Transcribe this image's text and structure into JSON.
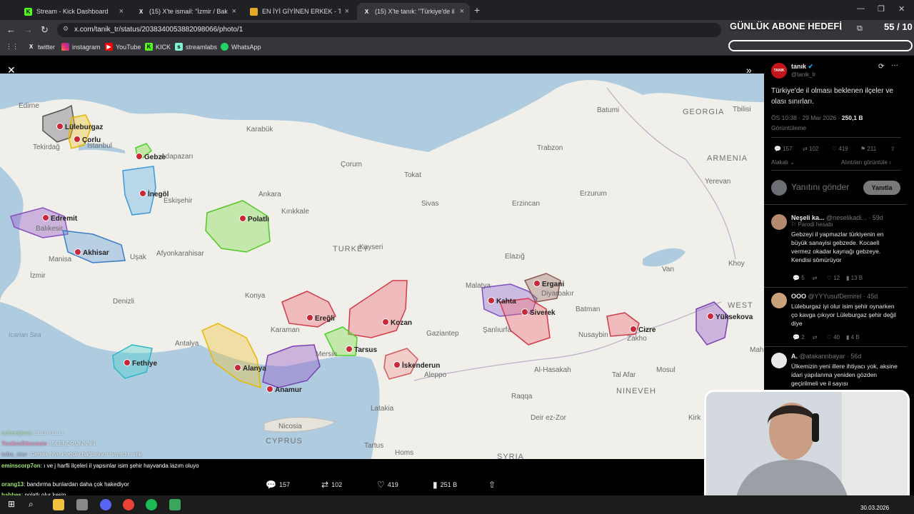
{
  "browser": {
    "tabs": [
      {
        "title": "Stream - Kick Dashboard"
      },
      {
        "title": "(15) X'te ismail: \"İzmir / Bakırçay..."
      },
      {
        "title": "EN İYİ GİYİNEN ERKEK - Tier Li..."
      },
      {
        "title": "(15) X'te tanık: \"Türkiye'de il ol..."
      }
    ],
    "url": "x.com/tanik_tr/status/2038340053882098066/photo/1",
    "bookmarks": [
      "twitter",
      "instagram",
      "YouTube",
      "KICK",
      "streamlabs",
      "WhatsApp"
    ]
  },
  "overlay": {
    "goal_label": "GÜNLÜK ABONE HEDEFİ",
    "goal_count": "55 / 10"
  },
  "map": {
    "cities": [
      "Lüleburgaz",
      "Çorlu",
      "Gebze",
      "İnegöl",
      "Edremit",
      "Akhisar",
      "Polatlı",
      "Ereğli",
      "Kozan",
      "Tarsus",
      "İskenderun",
      "Fethiye",
      "Alanya",
      "Anamur",
      "Kahta",
      "Siverek",
      "Ergani",
      "Cizre",
      "Yüksekova"
    ],
    "places": [
      "Edirne",
      "Tekirdağ",
      "İstanbul",
      "Adapazarı",
      "Karabük",
      "Çorum",
      "Tokat",
      "Sivas",
      "Erzincan",
      "Erzurum",
      "Trabzon",
      "Batumi",
      "GEORGIA",
      "Tbilisi",
      "ARMENIA",
      "Yerevan",
      "Ankara",
      "Kırıkkale",
      "Eskişehir",
      "Balıkesir",
      "Manisa",
      "Uşak",
      "Afyonkarahisar",
      "İzmir",
      "TURKEY",
      "Kayseri",
      "Elazığ",
      "Malatya",
      "Diyarbakır",
      "Batman",
      "Van",
      "Khoy",
      "Konya",
      "Denizli",
      "Antalya",
      "Karaman",
      "Mersin",
      "Gaziantep",
      "Şanlıurfa",
      "Nusaybin",
      "Zakho",
      "Mosul",
      "Al-Hasakah",
      "Tal Afar",
      "NINEVEH",
      "Raqqa",
      "Deir ez-Zor",
      "Latakia",
      "Aleppo",
      "Nicosia",
      "CYPRUS",
      "Tartus",
      "Homs",
      "SYRIA",
      "Kirk",
      "WEST",
      "Mah",
      "Icarian Sea"
    ]
  },
  "chat": [
    {
      "user": "eminscorp7on",
      "text": ": ı ve j harfli ilçeleri il yapsınlar isim şehir hayvanda lazım oluyo"
    },
    {
      "user": "orang13",
      "text": ": bandırma bunlardan daha çok hakediyor"
    },
    {
      "user": "habbes",
      "text": ": polatlı olur kesin"
    }
  ],
  "chat_faded": [
    {
      "user": "cebecipara",
      "text": ": olsun olsun"
    },
    {
      "user": "YesilunSiteneain",
      "text": ": ISLENDRUNNNN"
    },
    {
      "user": "tuba_star",
      "text": ": Gemlik niye inegöle bağlanıyor hayırdır amk"
    }
  ],
  "media_actions": {
    "replies": "157",
    "reposts": "102",
    "likes": "419",
    "views": "251 B"
  },
  "tweet": {
    "author": "tanık",
    "handle": "@tanik_tr",
    "avatar_text": "TANIK",
    "text": "Türkiye'de il olması beklenen ilçeler ve olası sınırları.",
    "time": "ÖS 10:38 · 29 Mar 2026 ·",
    "views": "250,1 B",
    "views_label": "Görüntüleme",
    "stats": {
      "replies": "157",
      "reposts": "102",
      "likes": "419",
      "bookmarks": "211"
    },
    "related_left": "Alakalı",
    "related_right": "Alıntıları görüntüle",
    "reply_placeholder": "Yanıtını gönder",
    "reply_button": "Yanıtla"
  },
  "replies": [
    {
      "name": "Neşeli ka...",
      "handle": "@neselikadi... · 59d",
      "badge": "Parodi hesabı",
      "text": "Gebzeyi il yapmazlar türkiyenin en büyük sanayisi gebzede. Kocaeli vermez okadar kaynağı gebzeye. Kendisi sömürüyor",
      "stats": [
        "5",
        "",
        "12",
        "13 B"
      ]
    },
    {
      "name": "OOO",
      "handle": "@YYYusufDemirel · 45d",
      "text": "Lüleburgaz iyi olur isim şehir oynarken ço kavga çıkıyor Lüleburgaz şehir değil diye",
      "stats": [
        "2",
        "",
        "40",
        "4 B"
      ]
    },
    {
      "name": "A.",
      "handle": "@atakannbayar · 56d",
      "text": "Ülkemizin yeni illere ihtiyacı yok, aksine idari yapılanma yeniden gözden geçirilmeli ve il sayısı"
    }
  ],
  "taskbar": {
    "date": "30.03.2026"
  }
}
